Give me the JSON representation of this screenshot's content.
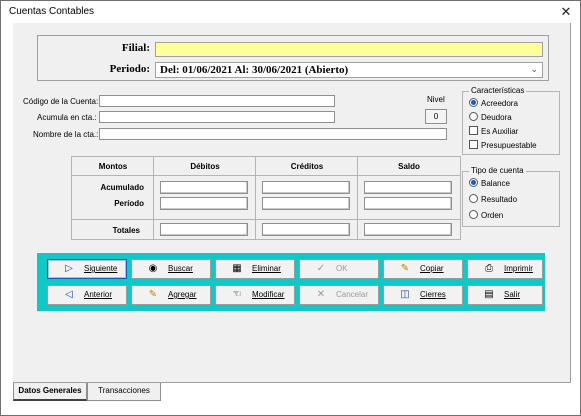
{
  "window": {
    "title": "Cuentas Contables",
    "close_glyph": "✕"
  },
  "header": {
    "filial_label": "Filial:",
    "filial_value": "",
    "periodo_label": "Periodo:",
    "periodo_value": "Del: 01/06/2021 Al: 30/06/2021 (Abierto)"
  },
  "account": {
    "codigo_label": "Código de la Cuenta:",
    "codigo_value": "",
    "acumula_label": "Acumula en cta.:",
    "acumula_value": "",
    "nombre_label": "Nombre de la cta.:",
    "nombre_value": "",
    "nivel_label": "Nivel",
    "nivel_value": "0"
  },
  "caracteristicas": {
    "title": "Características",
    "acreedora": "Acreedora",
    "deudora": "Deudora",
    "es_auxiliar": "Es Auxiliar",
    "presupuestable": "Presupuestable",
    "selected": "Acreedora"
  },
  "tipo_cuenta": {
    "title": "Tipo de cuenta",
    "balance": "Balance",
    "resultado": "Resultado",
    "orden": "Orden",
    "selected": "Balance"
  },
  "montos": {
    "headers": [
      "Montos",
      "Débitos",
      "Créditos",
      "Saldo"
    ],
    "acumulado_label": "Acumulado",
    "periodo_label": "Período",
    "totales_label": "Totales"
  },
  "actions": {
    "siguiente": "Siguiente",
    "buscar": "Buscar",
    "eliminar": "Eliminar",
    "ok": "OK",
    "copiar": "Copiar",
    "imprimir": "Imprimir",
    "anterior": "Anterior",
    "agregar": "Agregar",
    "modificar": "Modificar",
    "cancelar": "Cancelar",
    "cierres": "Cierres",
    "salir": "Salir",
    "panel_color": "#10c8c8"
  },
  "tabs": {
    "datos_generales": "Datos Generales",
    "transacciones": "Transacciones"
  },
  "icons": {
    "siguiente": "play-right-icon",
    "buscar": "binoculars-icon",
    "eliminar": "trash-icon",
    "ok": "checkmark-icon",
    "copiar": "pencil-icon",
    "imprimir": "printer-icon",
    "anterior": "play-left-icon",
    "agregar": "pencil-icon",
    "modificar": "hand-point-icon",
    "cancelar": "cross-icon",
    "cierres": "flow-boxes-icon",
    "salir": "door-exit-icon"
  }
}
